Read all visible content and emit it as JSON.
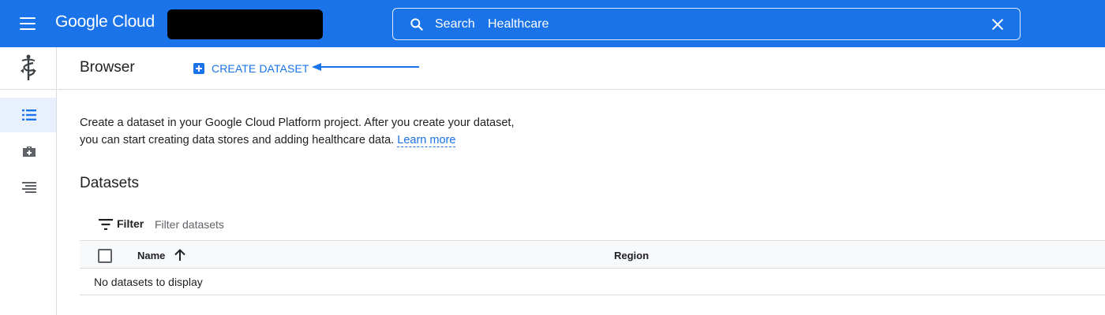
{
  "topbar": {
    "logo_text": "Google Cloud",
    "search": {
      "label": "Search",
      "value": "Healthcare"
    }
  },
  "rail": {
    "product_icon": "caduceus-icon",
    "items": [
      {
        "icon": "list-icon",
        "active": true
      },
      {
        "icon": "briefcase-plus-icon",
        "active": false
      },
      {
        "icon": "indented-list-icon",
        "active": false
      }
    ]
  },
  "header": {
    "title": "Browser",
    "create_label": "CREATE DATASET"
  },
  "main": {
    "intro_line1": "Create a dataset in your Google Cloud Platform project. After you create your dataset,",
    "intro_line2": "you can start creating data stores and adding healthcare data.",
    "learn_more": "Learn more",
    "section_title": "Datasets",
    "filter": {
      "label": "Filter",
      "placeholder": "Filter datasets"
    },
    "table": {
      "columns": [
        "Name",
        "Region"
      ],
      "sort": "ascending",
      "empty_message": "No datasets to display"
    }
  },
  "colors": {
    "accent": "#1a73e8",
    "rail_active": "#e8f0fe",
    "border": "#dadce0"
  }
}
